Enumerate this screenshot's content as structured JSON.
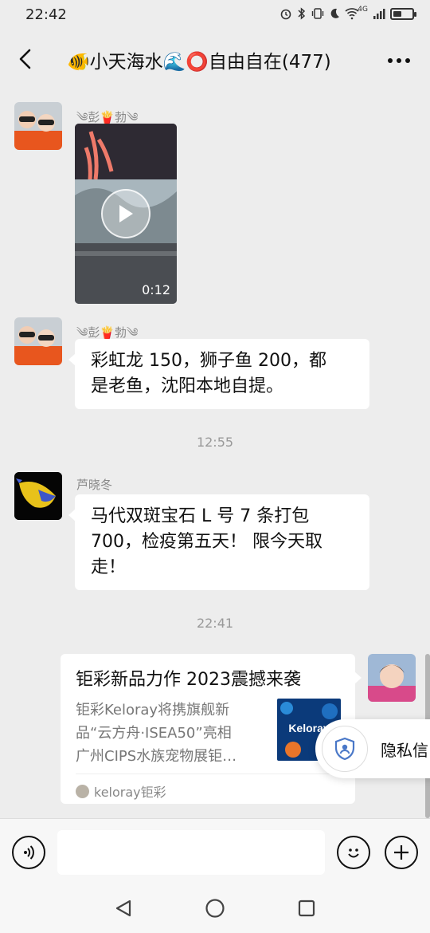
{
  "status_bar": {
    "time": "22:42",
    "icons": [
      "alarm-icon",
      "bluetooth-icon",
      "vibrate-icon",
      "moon-icon",
      "wifi-icon",
      "signal-icon",
      "battery-icon"
    ],
    "network": "4G",
    "battery_level": 0.45
  },
  "header": {
    "title": "🐠小天海水🌊⭕自由自在(477)",
    "back_icon": "chevron-left-icon",
    "more_icon": "more-horizontal-icon"
  },
  "messages": [
    {
      "type": "video",
      "sender": "༄彭🍟勃༄",
      "duration": "0:12"
    },
    {
      "type": "text",
      "sender": "༄彭🍟勃༄",
      "lines": [
        "彩虹龙 150，狮子鱼 200，都",
        "是老鱼，沈阳本地自提。"
      ]
    },
    {
      "type": "timestamp",
      "text": "12:55"
    },
    {
      "type": "text",
      "sender": "芦晓冬",
      "lines": [
        "马代双斑宝石 L 号  7 条打包",
        "700，检疫第五天！ 限今天取",
        "走！"
      ]
    },
    {
      "type": "timestamp",
      "text": "22:41"
    },
    {
      "type": "link_card",
      "title": "钜彩新品力作 2023震撼来袭",
      "description_lines": [
        "钜彩Keloray将携旗舰新",
        "品“云方舟·ISEA50”亮相",
        "广州CIPS水族宠物展钜…"
      ],
      "thumb_text": "Keloray",
      "source": "keloray钜彩"
    }
  ],
  "privacy_popup": {
    "label": "隐私信",
    "icon": "shield-user-icon"
  },
  "input_bar": {
    "voice_icon": "voice-icon",
    "emoji_icon": "emoji-icon",
    "plus_icon": "plus-icon",
    "text_value": ""
  },
  "nav_bar": {
    "icons": [
      "back-triangle-icon",
      "home-circle-icon",
      "recents-square-icon"
    ]
  },
  "colors": {
    "background": "#ededed",
    "bubble": "#ffffff",
    "muted_text": "#888888"
  }
}
